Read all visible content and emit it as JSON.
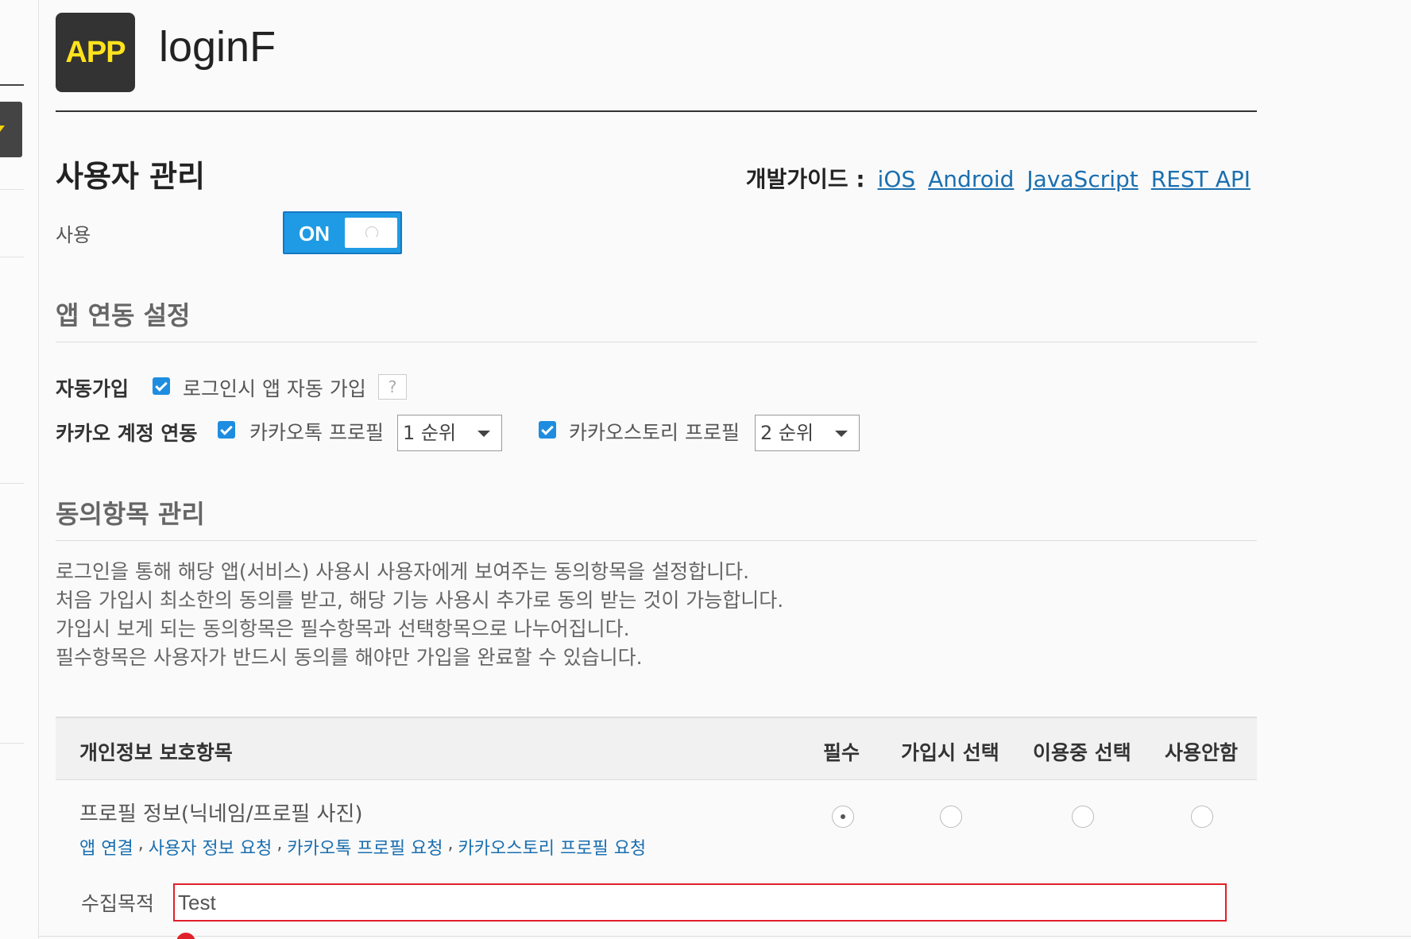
{
  "app": {
    "logo_text": "APP",
    "name": "loginF"
  },
  "section": {
    "title": "사용자 관리"
  },
  "dev_guide": {
    "label": "개발가이드 :",
    "links": [
      "iOS",
      "Android",
      "JavaScript",
      "REST API"
    ]
  },
  "usage": {
    "label": "사용",
    "toggle_label": "ON"
  },
  "app_link_settings": {
    "title": "앱 연동 설정",
    "auto_signup": {
      "label": "자동가입",
      "checkbox_label": "로그인시 앱 자동 가입",
      "help": "?"
    },
    "kakao_link": {
      "label": "카카오 계정 연동",
      "talk_profile": {
        "checkbox_label": "카카오톡 프로필",
        "priority": "1 순위"
      },
      "story_profile": {
        "checkbox_label": "카카오스토리 프로필",
        "priority": "2 순위"
      }
    }
  },
  "consent": {
    "title": "동의항목 관리",
    "description": [
      "로그인을 통해 해당 앱(서비스) 사용시 사용자에게 보여주는 동의항목을 설정합니다.",
      "처음 가입시 최소한의 동의를 받고, 해당 기능 사용시 추가로 동의 받는 것이 가능합니다.",
      "가입시 보게 되는 동의항목은 필수항목과 선택항목으로 나누어집니다.",
      "필수항목은 사용자가 반드시 동의를 해야만 가입을 완료할 수 있습니다."
    ],
    "table": {
      "columns": [
        "개인정보 보호항목",
        "필수",
        "가입시 선택",
        "이용중 선택",
        "사용안함"
      ],
      "item": {
        "title": "프로필 정보(닉네임/프로필 사진)",
        "links": [
          "앱 연결",
          "사용자 정보 요청",
          "카카오톡 프로필 요청",
          "카카오스토리 프로필 요청"
        ],
        "separator": ",",
        "selected": "필수"
      }
    },
    "purpose": {
      "label": "수집목적",
      "value": "Test"
    }
  }
}
